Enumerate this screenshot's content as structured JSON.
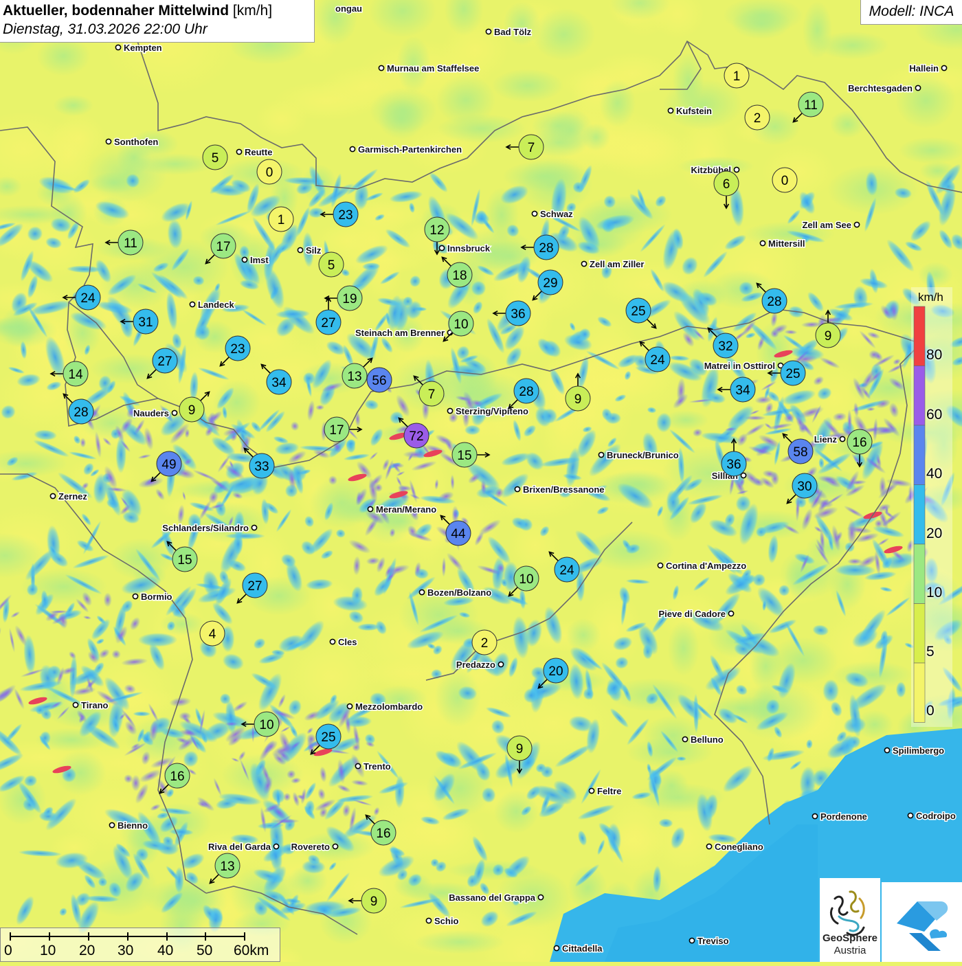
{
  "title": {
    "main": "Aktueller, bodennaher Mittelwind",
    "unit": "[km/h]",
    "date": "Dienstag, 31.03.2026 22:00 Uhr"
  },
  "model": "Modell: INCA",
  "legend": {
    "unit": "km/h",
    "labels": [
      "80",
      "60",
      "40",
      "20",
      "10",
      "5",
      "0"
    ],
    "colors": [
      "#f04040",
      "#9a5ce8",
      "#5a85ee",
      "#34bcec",
      "#9be882",
      "#d8ee4c",
      "#f4f46a"
    ]
  },
  "scale": {
    "labels": [
      "0",
      "10",
      "20",
      "30",
      "40",
      "50",
      "60km"
    ]
  },
  "logo": {
    "name": "GeoSphere",
    "sub": "Austria"
  },
  "colors": {
    "yellow": "#f4f46a",
    "lightgreen": "#c9ee58",
    "green": "#9be882",
    "cyan": "#34bcec",
    "blue": "#5a85ee",
    "purple": "#9a5ce8",
    "red": "#f04040"
  },
  "cities": [
    {
      "name": "Kempten"
    },
    {
      "name": "Bad Tölz"
    },
    {
      "name": "Murnau am Staffelsee"
    },
    {
      "name": "Hallein"
    },
    {
      "name": "Berchtesgaden"
    },
    {
      "name": "Kufstein"
    },
    {
      "name": "Sonthofen"
    },
    {
      "name": "Reutte"
    },
    {
      "name": "Garmisch-Partenkirchen"
    },
    {
      "name": "Kitzbühel"
    },
    {
      "name": "Zell am See"
    },
    {
      "name": "Schwaz"
    },
    {
      "name": "Innsbruck"
    },
    {
      "name": "Mittersill"
    },
    {
      "name": "Silz"
    },
    {
      "name": "Imst"
    },
    {
      "name": "Zell am Ziller"
    },
    {
      "name": "Landeck"
    },
    {
      "name": "Steinach am Brenner"
    },
    {
      "name": "Matrei in Osttirol"
    },
    {
      "name": "Nauders"
    },
    {
      "name": "Sterzing/Vipiteno"
    },
    {
      "name": "Lienz"
    },
    {
      "name": "Bruneck/Brunico"
    },
    {
      "name": "Sillian"
    },
    {
      "name": "Brixen/Bressanone"
    },
    {
      "name": "Zernez"
    },
    {
      "name": "Meran/Merano"
    },
    {
      "name": "Schlanders/Silandro"
    },
    {
      "name": "Cortina d'Ampezzo"
    },
    {
      "name": "Bormio"
    },
    {
      "name": "Bozen/Bolzano"
    },
    {
      "name": "Pieve di Cadore"
    },
    {
      "name": "Cles"
    },
    {
      "name": "Predazzo"
    },
    {
      "name": "Tirano"
    },
    {
      "name": "Mezzolombardo"
    },
    {
      "name": "Belluno"
    },
    {
      "name": "Spilimbergo"
    },
    {
      "name": "Trento"
    },
    {
      "name": "Feltre"
    },
    {
      "name": "Pordenone"
    },
    {
      "name": "Codroipo"
    },
    {
      "name": "Bienno"
    },
    {
      "name": "Riva del Garda"
    },
    {
      "name": "Rovereto"
    },
    {
      "name": "Conegliano"
    },
    {
      "name": "Bassano del Grappa"
    },
    {
      "name": "Schio"
    },
    {
      "name": "Treviso"
    },
    {
      "name": "Cittadella"
    },
    {
      "name": "ongau"
    }
  ],
  "stations": [
    {
      "value": "1",
      "dir": "none"
    },
    {
      "value": "2",
      "dir": "none"
    },
    {
      "value": "11",
      "dir": "sw"
    },
    {
      "value": "7",
      "dir": "w"
    },
    {
      "value": "5",
      "dir": "none"
    },
    {
      "value": "0",
      "dir": "none"
    },
    {
      "value": "6",
      "dir": "s"
    },
    {
      "value": "0",
      "dir": "none"
    },
    {
      "value": "23",
      "dir": "w"
    },
    {
      "value": "1",
      "dir": "none"
    },
    {
      "value": "12",
      "dir": "s"
    },
    {
      "value": "11",
      "dir": "w"
    },
    {
      "value": "17",
      "dir": "sw"
    },
    {
      "value": "5",
      "dir": "none"
    },
    {
      "value": "28",
      "dir": "w"
    },
    {
      "value": "18",
      "dir": "nw"
    },
    {
      "value": "29",
      "dir": "sw"
    },
    {
      "value": "24",
      "dir": "w"
    },
    {
      "value": "19",
      "dir": "w"
    },
    {
      "value": "27",
      "dir": "n"
    },
    {
      "value": "10",
      "dir": "sw"
    },
    {
      "value": "36",
      "dir": "w"
    },
    {
      "value": "25",
      "dir": "se"
    },
    {
      "value": "28",
      "dir": "nw"
    },
    {
      "value": "9",
      "dir": "n"
    },
    {
      "value": "31",
      "dir": "w"
    },
    {
      "value": "32",
      "dir": "nw"
    },
    {
      "value": "23",
      "dir": "sw"
    },
    {
      "value": "27",
      "dir": "sw"
    },
    {
      "value": "24",
      "dir": "nw"
    },
    {
      "value": "25",
      "dir": "w"
    },
    {
      "value": "14",
      "dir": "w"
    },
    {
      "value": "34",
      "dir": "nw"
    },
    {
      "value": "13",
      "dir": "ne"
    },
    {
      "value": "56",
      "dir": "none"
    },
    {
      "value": "7",
      "dir": "nw"
    },
    {
      "value": "28",
      "dir": "sw"
    },
    {
      "value": "9",
      "dir": "n"
    },
    {
      "value": "34",
      "dir": "w"
    },
    {
      "value": "28",
      "dir": "nw"
    },
    {
      "value": "9",
      "dir": "ne"
    },
    {
      "value": "17",
      "dir": "e"
    },
    {
      "value": "72",
      "dir": "nw"
    },
    {
      "value": "16",
      "dir": "s"
    },
    {
      "value": "15",
      "dir": "e"
    },
    {
      "value": "58",
      "dir": "nw"
    },
    {
      "value": "49",
      "dir": "sw"
    },
    {
      "value": "33",
      "dir": "nw"
    },
    {
      "value": "36",
      "dir": "n"
    },
    {
      "value": "30",
      "dir": "sw"
    },
    {
      "value": "44",
      "dir": "nw"
    },
    {
      "value": "15",
      "dir": "nw"
    },
    {
      "value": "24",
      "dir": "nw"
    },
    {
      "value": "10",
      "dir": "sw"
    },
    {
      "value": "27",
      "dir": "sw"
    },
    {
      "value": "4",
      "dir": "none"
    },
    {
      "value": "2",
      "dir": "none"
    },
    {
      "value": "20",
      "dir": "sw"
    },
    {
      "value": "10",
      "dir": "w"
    },
    {
      "value": "25",
      "dir": "sw"
    },
    {
      "value": "9",
      "dir": "s"
    },
    {
      "value": "16",
      "dir": "sw"
    },
    {
      "value": "16",
      "dir": "nw"
    },
    {
      "value": "13",
      "dir": "sw"
    },
    {
      "value": "9",
      "dir": "w"
    }
  ]
}
